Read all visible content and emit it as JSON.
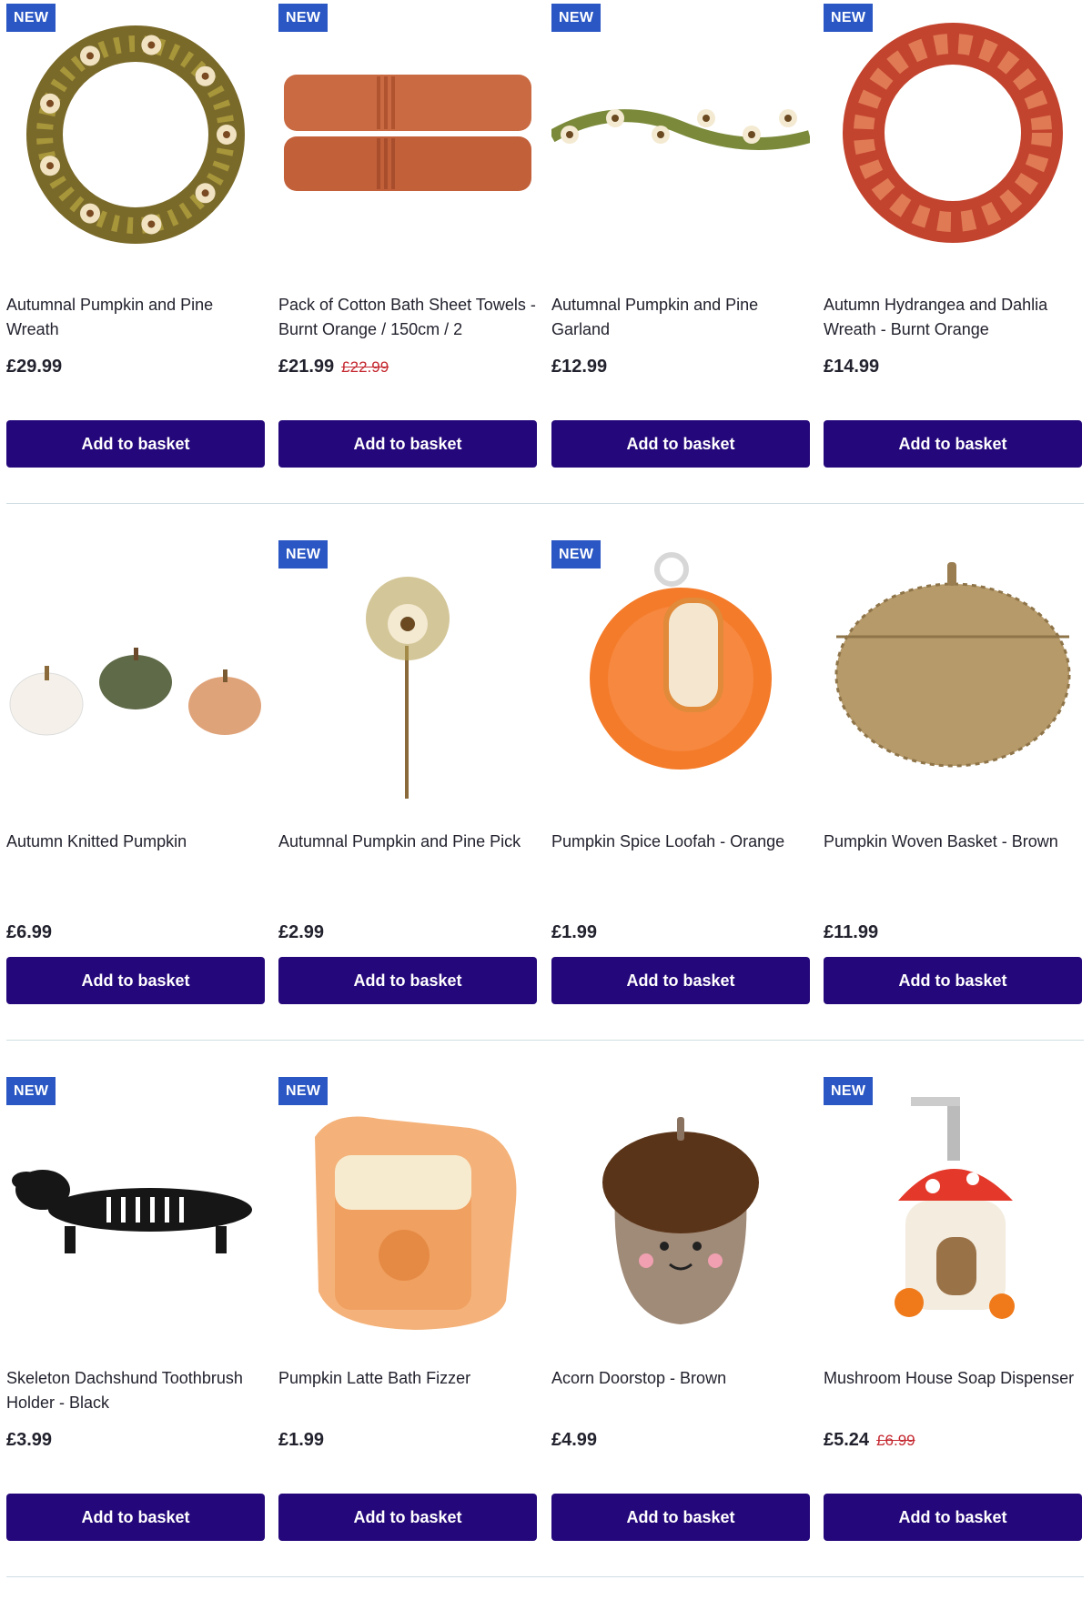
{
  "colors": {
    "badge": "#2a57c4",
    "button": "#24077a",
    "was_price": "#c4262e",
    "divider": "#cfdde3"
  },
  "button_label": "Add to basket",
  "badge_label": "NEW",
  "products": [
    {
      "title": "Autumnal Pumpkin and Pine Wreath",
      "price": "£29.99",
      "was": "",
      "new": true,
      "image": "wreath-icon"
    },
    {
      "title": "Pack of Cotton Bath Sheet Towels - Burnt Orange / 150cm / 2",
      "price": "£21.99",
      "was": "£22.99",
      "new": true,
      "image": "towels-icon"
    },
    {
      "title": "Autumnal Pumpkin and Pine Garland",
      "price": "£12.99",
      "was": "",
      "new": true,
      "image": "garland-icon"
    },
    {
      "title": "Autumn Hydrangea and Dahlia Wreath - Burnt Orange",
      "price": "£14.99",
      "was": "",
      "new": true,
      "image": "red-wreath-icon"
    },
    {
      "title": "Autumn Knitted Pumpkin",
      "price": "£6.99",
      "was": "",
      "new": false,
      "image": "knitted-pumpkins-icon"
    },
    {
      "title": "Autumnal Pumpkin and Pine Pick",
      "price": "£2.99",
      "was": "",
      "new": true,
      "image": "flower-pick-icon"
    },
    {
      "title": "Pumpkin Spice Loofah - Orange",
      "price": "£1.99",
      "was": "",
      "new": true,
      "image": "loofah-icon"
    },
    {
      "title": "Pumpkin Woven Basket - Brown",
      "price": "£11.99",
      "was": "",
      "new": false,
      "image": "woven-basket-icon"
    },
    {
      "title": "Skeleton Dachshund Toothbrush Holder - Black",
      "price": "£3.99",
      "was": "",
      "new": true,
      "image": "dachshund-icon"
    },
    {
      "title": "Pumpkin Latte Bath Fizzer",
      "price": "£1.99",
      "was": "",
      "new": true,
      "image": "bath-fizzer-icon"
    },
    {
      "title": "Acorn Doorstop - Brown",
      "price": "£4.99",
      "was": "",
      "new": false,
      "image": "acorn-icon"
    },
    {
      "title": "Mushroom House Soap Dispenser",
      "price": "£5.24",
      "was": "£6.99",
      "new": true,
      "image": "soap-dispenser-icon"
    }
  ]
}
